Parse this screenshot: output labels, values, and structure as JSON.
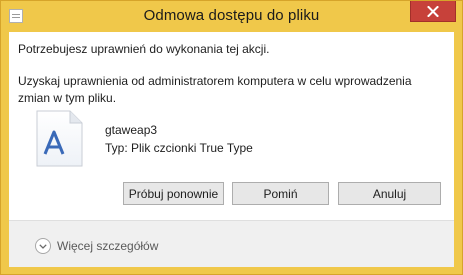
{
  "window": {
    "title": "Odmowa dostępu do pliku",
    "app_icon": "document-icon",
    "close_icon": "close-icon"
  },
  "message": {
    "line1": "Potrzebujesz uprawnień do wykonania tej akcji.",
    "line2": "Uzyskaj uprawnienia od administratorem komputera w celu wprowadzenia zmian w tym pliku."
  },
  "file": {
    "icon": "font-file-icon",
    "name": "gtaweap3",
    "type": "Typ: Plik czcionki True Type"
  },
  "buttons": {
    "retry": "Próbuj ponownie",
    "skip": "Pomiń",
    "cancel": "Anuluj"
  },
  "footer": {
    "details": "Więcej szczegółów",
    "details_icon": "chevron-down-icon"
  },
  "colors": {
    "frame": "#f0c84a",
    "close_button": "#c7413a",
    "content_bg": "#ffffff",
    "footer_bg": "#f0f0f0"
  }
}
